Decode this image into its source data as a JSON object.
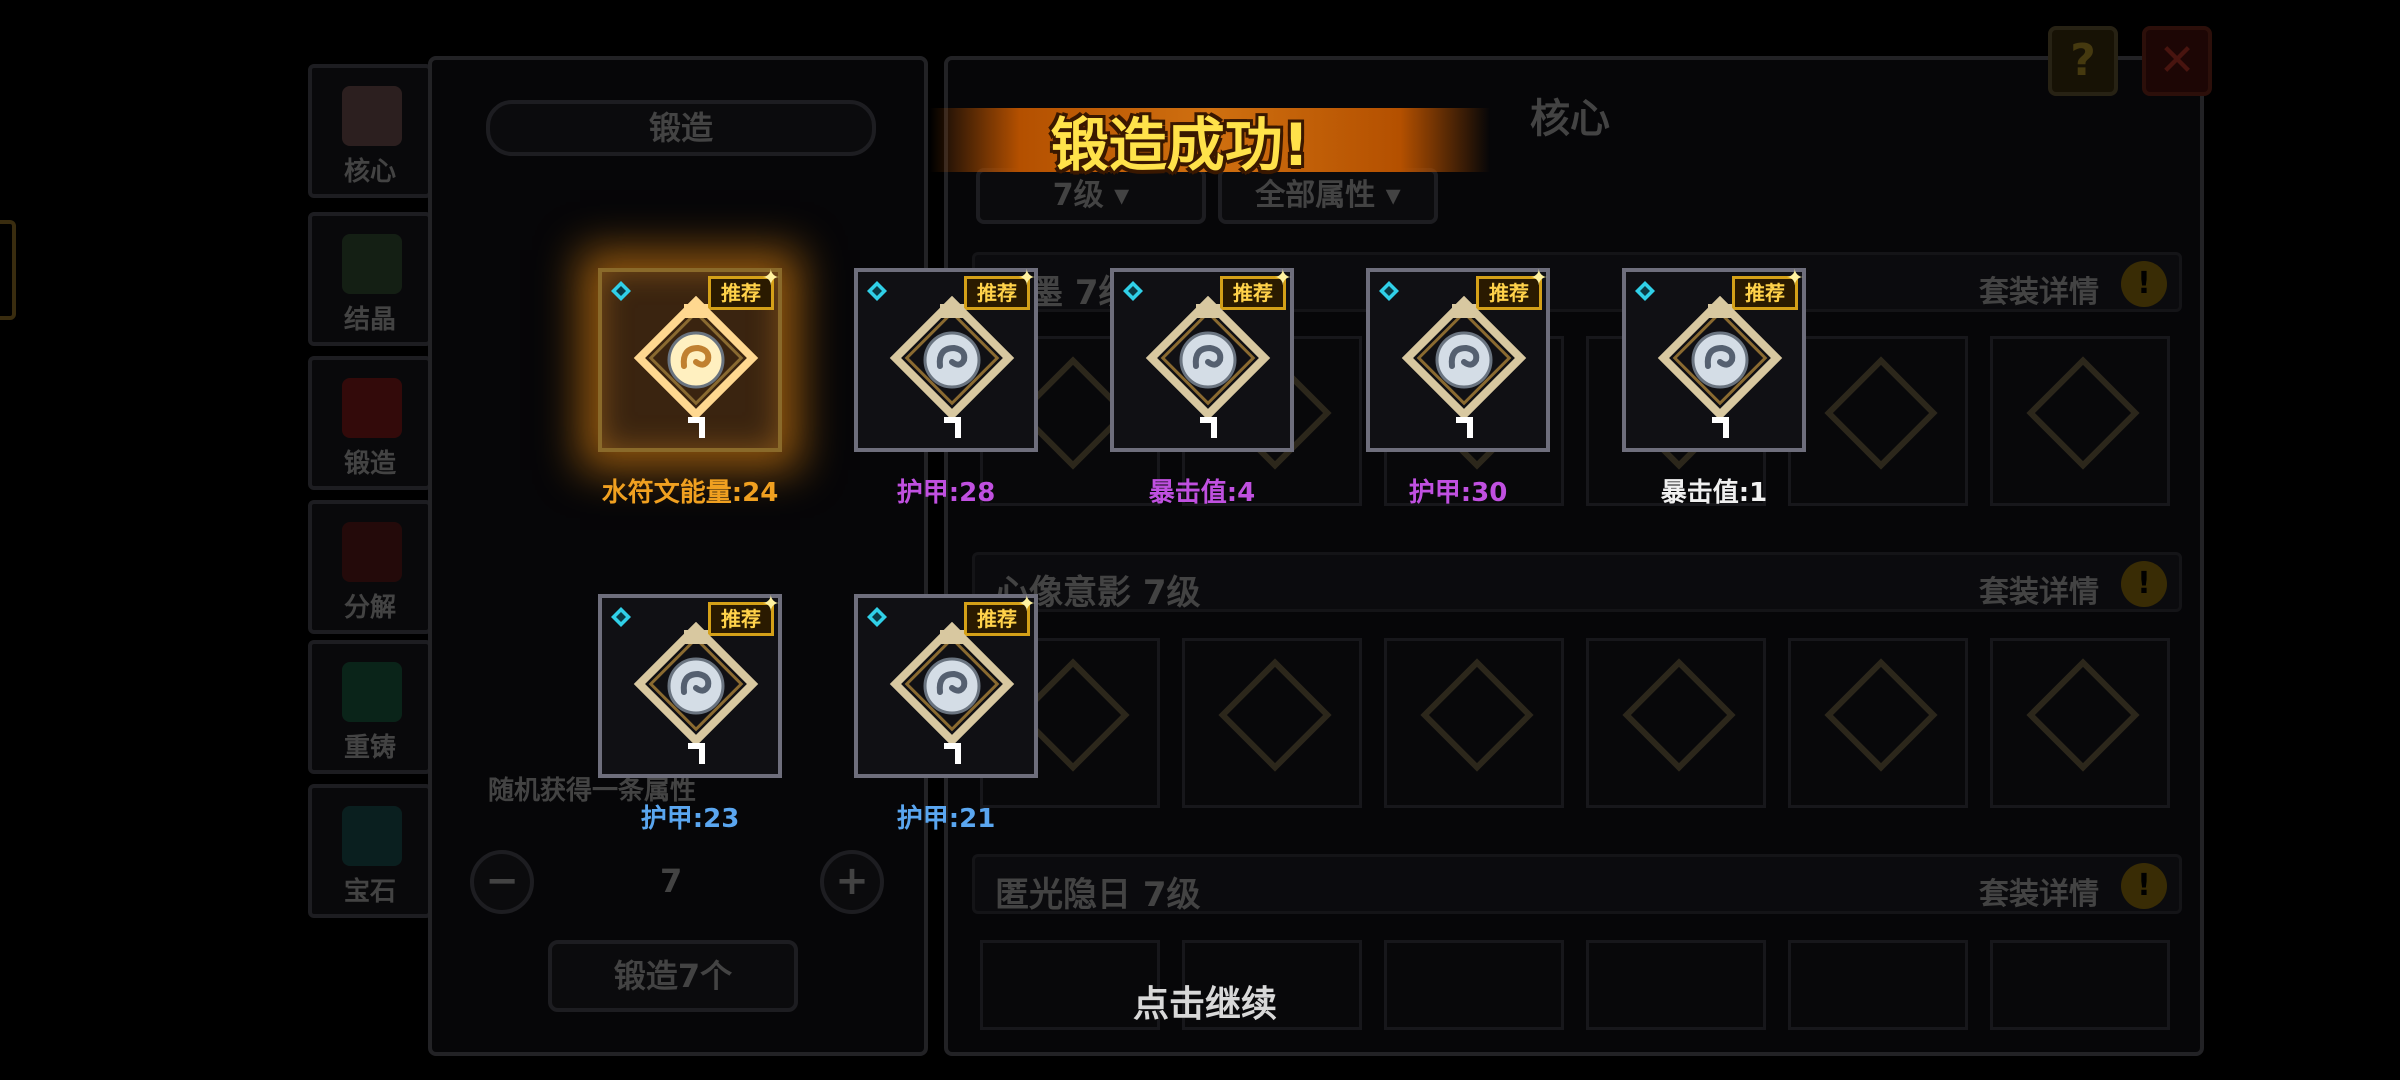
{
  "banner": {
    "title": "锻造成功!"
  },
  "continue_label": "点击继续",
  "background": {
    "left_nav": [
      "核心",
      "结晶",
      "锻造",
      "分解",
      "重铸",
      "宝石"
    ],
    "forge_panel": {
      "title": "锻造",
      "random_attr_label": "随机获得一条属性",
      "quantity": "7",
      "forge_button": "锻造7个"
    },
    "core_panel": {
      "title": "核心",
      "level_filter": "7级",
      "attr_filter": "全部属性",
      "set_rows": [
        {
          "name": "浪墨 7级",
          "detail": "套装详情"
        },
        {
          "name": "心像意影 7级",
          "detail": "套装详情"
        },
        {
          "name": "匿光隐日 7级",
          "detail": "套装详情"
        }
      ]
    },
    "help_icon": "?",
    "close_icon": "✕"
  },
  "results": [
    {
      "badge": "推荐",
      "label": "水符文能量:24",
      "color": "#f0a020",
      "glow": true
    },
    {
      "badge": "推荐",
      "label": "护甲:28",
      "color": "#c050e0",
      "glow": false
    },
    {
      "badge": "推荐",
      "label": "暴击值:4",
      "color": "#c050e0",
      "glow": false
    },
    {
      "badge": "推荐",
      "label": "护甲:30",
      "color": "#c050e0",
      "glow": false
    },
    {
      "badge": "推荐",
      "label": "暴击值:1",
      "color": "#f0f0f0",
      "glow": false
    },
    {
      "badge": "推荐",
      "label": "护甲:23",
      "color": "#5aa6f0",
      "glow": false
    },
    {
      "badge": "推荐",
      "label": "护甲:21",
      "color": "#5aa6f0",
      "glow": false
    }
  ]
}
